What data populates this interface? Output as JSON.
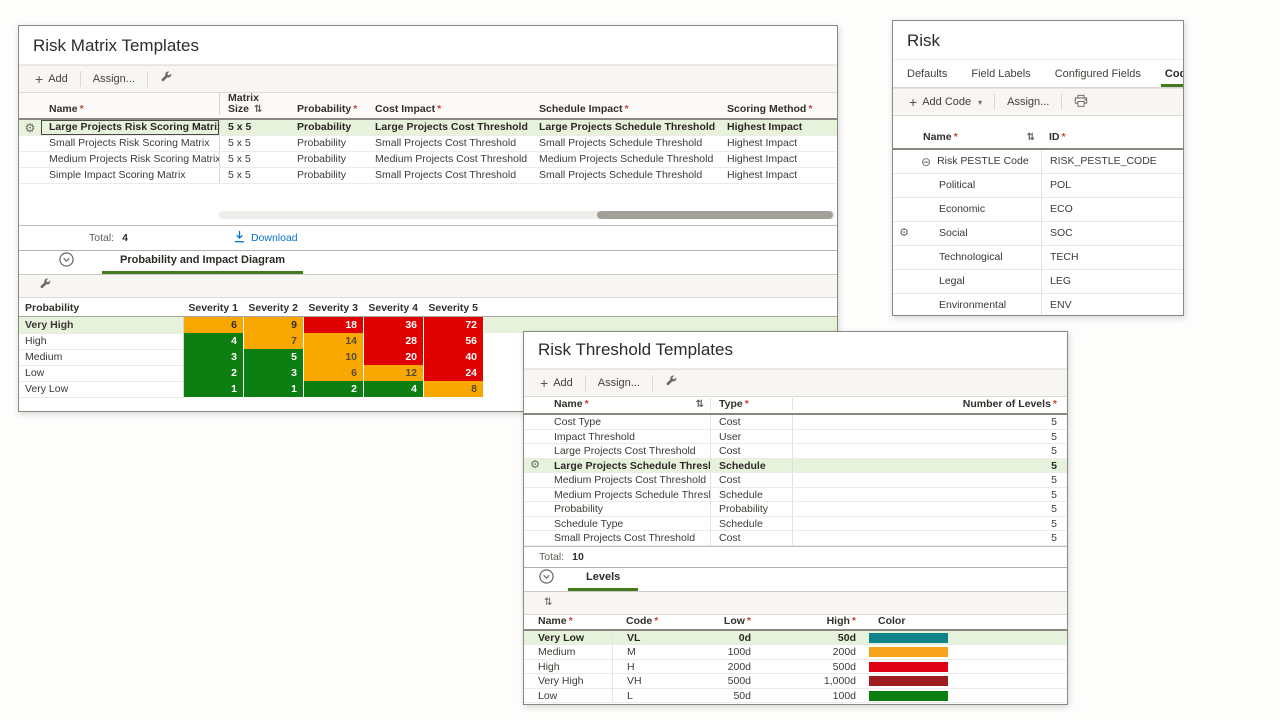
{
  "colors": {
    "matrix_green": "#0d7f12",
    "matrix_orange": "#f8a800",
    "matrix_red": "#e00000",
    "selected_row_green": "#e7f2dc",
    "active_tab_green": "#447a22",
    "link_blue": "#0572ce",
    "required_asterisk_red": "#c74634"
  },
  "matrix_panel": {
    "title": "Risk Matrix Templates",
    "toolbar": {
      "add_label": "Add",
      "assign_label": "Assign..."
    },
    "table": {
      "columns": [
        {
          "label": "Name",
          "required": true,
          "sort": false
        },
        {
          "label": "Matrix Size",
          "required": false,
          "sort": true
        },
        {
          "label": "Probability",
          "required": true,
          "sort": false
        },
        {
          "label": "Cost Impact",
          "required": true,
          "sort": false
        },
        {
          "label": "Schedule Impact",
          "required": true,
          "sort": false
        },
        {
          "label": "Scoring Method",
          "required": true,
          "sort": false
        }
      ],
      "rows": [
        {
          "name": "Large Projects Risk Scoring Matrix",
          "matrix_size": "5 x 5",
          "probability": "Probability",
          "cost_impact": "Large Projects Cost Threshold",
          "schedule_impact": "Large Projects Schedule Threshold",
          "scoring_method": "Highest Impact",
          "selected": true
        },
        {
          "name": "Small Projects Risk Scoring Matrix",
          "matrix_size": "5 x 5",
          "probability": "Probability",
          "cost_impact": "Small Projects Cost Threshold",
          "schedule_impact": "Small Projects Schedule Threshold",
          "scoring_method": "Highest Impact",
          "selected": false
        },
        {
          "name": "Medium Projects Risk Scoring Matrix",
          "matrix_size": "5 x 5",
          "probability": "Probability",
          "cost_impact": "Medium Projects Cost Threshold",
          "schedule_impact": "Medium Projects Schedule Threshold",
          "scoring_method": "Highest Impact",
          "selected": false
        },
        {
          "name": "Simple Impact Scoring Matrix",
          "matrix_size": "5 x 5",
          "probability": "Probability",
          "cost_impact": "Small Projects Cost Threshold",
          "schedule_impact": "Small Projects Schedule Threshold",
          "scoring_method": "Highest Impact",
          "selected": false
        }
      ],
      "total_label": "Total:",
      "total_value": "4",
      "download_label": "Download"
    },
    "section": {
      "title": "Probability and Impact Diagram",
      "diagram": {
        "header": [
          "Probability",
          "Severity 1",
          "Severity 2",
          "Severity 3",
          "Severity 4",
          "Severity 5"
        ],
        "rows": [
          {
            "label": "Very High",
            "selected": true,
            "cells": [
              {
                "v": "6",
                "c": "orange"
              },
              {
                "v": "9",
                "c": "orange"
              },
              {
                "v": "18",
                "c": "red"
              },
              {
                "v": "36",
                "c": "red"
              },
              {
                "v": "72",
                "c": "red"
              }
            ]
          },
          {
            "label": "High",
            "selected": false,
            "cells": [
              {
                "v": "4",
                "c": "green"
              },
              {
                "v": "7",
                "c": "orange"
              },
              {
                "v": "14",
                "c": "orange"
              },
              {
                "v": "28",
                "c": "red"
              },
              {
                "v": "56",
                "c": "red"
              }
            ]
          },
          {
            "label": "Medium",
            "selected": false,
            "cells": [
              {
                "v": "3",
                "c": "green"
              },
              {
                "v": "5",
                "c": "green"
              },
              {
                "v": "10",
                "c": "orange"
              },
              {
                "v": "20",
                "c": "red"
              },
              {
                "v": "40",
                "c": "red"
              }
            ]
          },
          {
            "label": "Low",
            "selected": false,
            "cells": [
              {
                "v": "2",
                "c": "green"
              },
              {
                "v": "3",
                "c": "green"
              },
              {
                "v": "6",
                "c": "orange"
              },
              {
                "v": "12",
                "c": "orange"
              },
              {
                "v": "24",
                "c": "red"
              }
            ]
          },
          {
            "label": "Very Low",
            "selected": false,
            "cells": [
              {
                "v": "1",
                "c": "green"
              },
              {
                "v": "1",
                "c": "green"
              },
              {
                "v": "2",
                "c": "green"
              },
              {
                "v": "4",
                "c": "green"
              },
              {
                "v": "8",
                "c": "orange"
              }
            ]
          }
        ]
      }
    }
  },
  "risk_panel": {
    "title": "Risk",
    "tabs": [
      {
        "label": "Defaults",
        "active": false
      },
      {
        "label": "Field Labels",
        "active": false
      },
      {
        "label": "Configured Fields",
        "active": false
      },
      {
        "label": "Codes",
        "active": true
      }
    ],
    "toolbar": {
      "add_code_label": "Add Code",
      "assign_label": "Assign..."
    },
    "table": {
      "columns": [
        {
          "label": "Name",
          "required": true,
          "sort": true
        },
        {
          "label": "ID",
          "required": true,
          "sort": false
        }
      ],
      "rows": [
        {
          "name": "Risk PESTLE Code",
          "id": "RISK_PESTLE_CODE",
          "parent": true,
          "gear": false
        },
        {
          "name": "Political",
          "id": "POL",
          "parent": false,
          "gear": false
        },
        {
          "name": "Economic",
          "id": "ECO",
          "parent": false,
          "gear": false
        },
        {
          "name": "Social",
          "id": "SOC",
          "parent": false,
          "gear": true
        },
        {
          "name": "Technological",
          "id": "TECH",
          "parent": false,
          "gear": false
        },
        {
          "name": "Legal",
          "id": "LEG",
          "parent": false,
          "gear": false
        },
        {
          "name": "Environmental",
          "id": "ENV",
          "parent": false,
          "gear": false
        }
      ]
    }
  },
  "threshold_panel": {
    "title": "Risk Threshold Templates",
    "toolbar": {
      "add_label": "Add",
      "assign_label": "Assign..."
    },
    "table": {
      "columns": [
        {
          "label": "Name",
          "required": true,
          "sort": true
        },
        {
          "label": "Type",
          "required": true,
          "sort": false
        },
        {
          "label": "Number of Levels",
          "required": true,
          "sort": false
        }
      ],
      "rows": [
        {
          "name": "Cost Type",
          "type": "Cost",
          "levels": "5",
          "selected": false
        },
        {
          "name": "Impact Threshold",
          "type": "User",
          "levels": "5",
          "selected": false
        },
        {
          "name": "Large Projects Cost Threshold",
          "type": "Cost",
          "levels": "5",
          "selected": false
        },
        {
          "name": "Large Projects Schedule Threshold",
          "type": "Schedule",
          "levels": "5",
          "selected": true
        },
        {
          "name": "Medium Projects Cost Threshold",
          "type": "Cost",
          "levels": "5",
          "selected": false
        },
        {
          "name": "Medium Projects Schedule Threshold",
          "type": "Schedule",
          "levels": "5",
          "selected": false
        },
        {
          "name": "Probability",
          "type": "Probability",
          "levels": "5",
          "selected": false
        },
        {
          "name": "Schedule Type",
          "type": "Schedule",
          "levels": "5",
          "selected": false
        },
        {
          "name": "Small Projects Cost Threshold",
          "type": "Cost",
          "levels": "5",
          "selected": false
        }
      ],
      "total_label": "Total:",
      "total_value": "10"
    },
    "section": {
      "title": "Levels",
      "table": {
        "columns": [
          {
            "label": "Name",
            "required": true
          },
          {
            "label": "Code",
            "required": true
          },
          {
            "label": "Low",
            "required": true,
            "right": true
          },
          {
            "label": "High",
            "required": true,
            "right": true
          },
          {
            "label": "Color",
            "required": false
          }
        ],
        "rows": [
          {
            "name": "Very Low",
            "code": "VL",
            "low": "0d",
            "high": "50d",
            "color": "#11848a",
            "selected": true
          },
          {
            "name": "Medium",
            "code": "M",
            "low": "100d",
            "high": "200d",
            "color": "#f7a41c",
            "selected": false
          },
          {
            "name": "High",
            "code": "H",
            "low": "200d",
            "high": "500d",
            "color": "#e00013",
            "selected": false
          },
          {
            "name": "Very High",
            "code": "VH",
            "low": "500d",
            "high": "1,000d",
            "color": "#9e1b1e",
            "selected": false
          },
          {
            "name": "Low",
            "code": "L",
            "low": "50d",
            "high": "100d",
            "color": "#0b7e12",
            "selected": false
          }
        ]
      }
    }
  }
}
